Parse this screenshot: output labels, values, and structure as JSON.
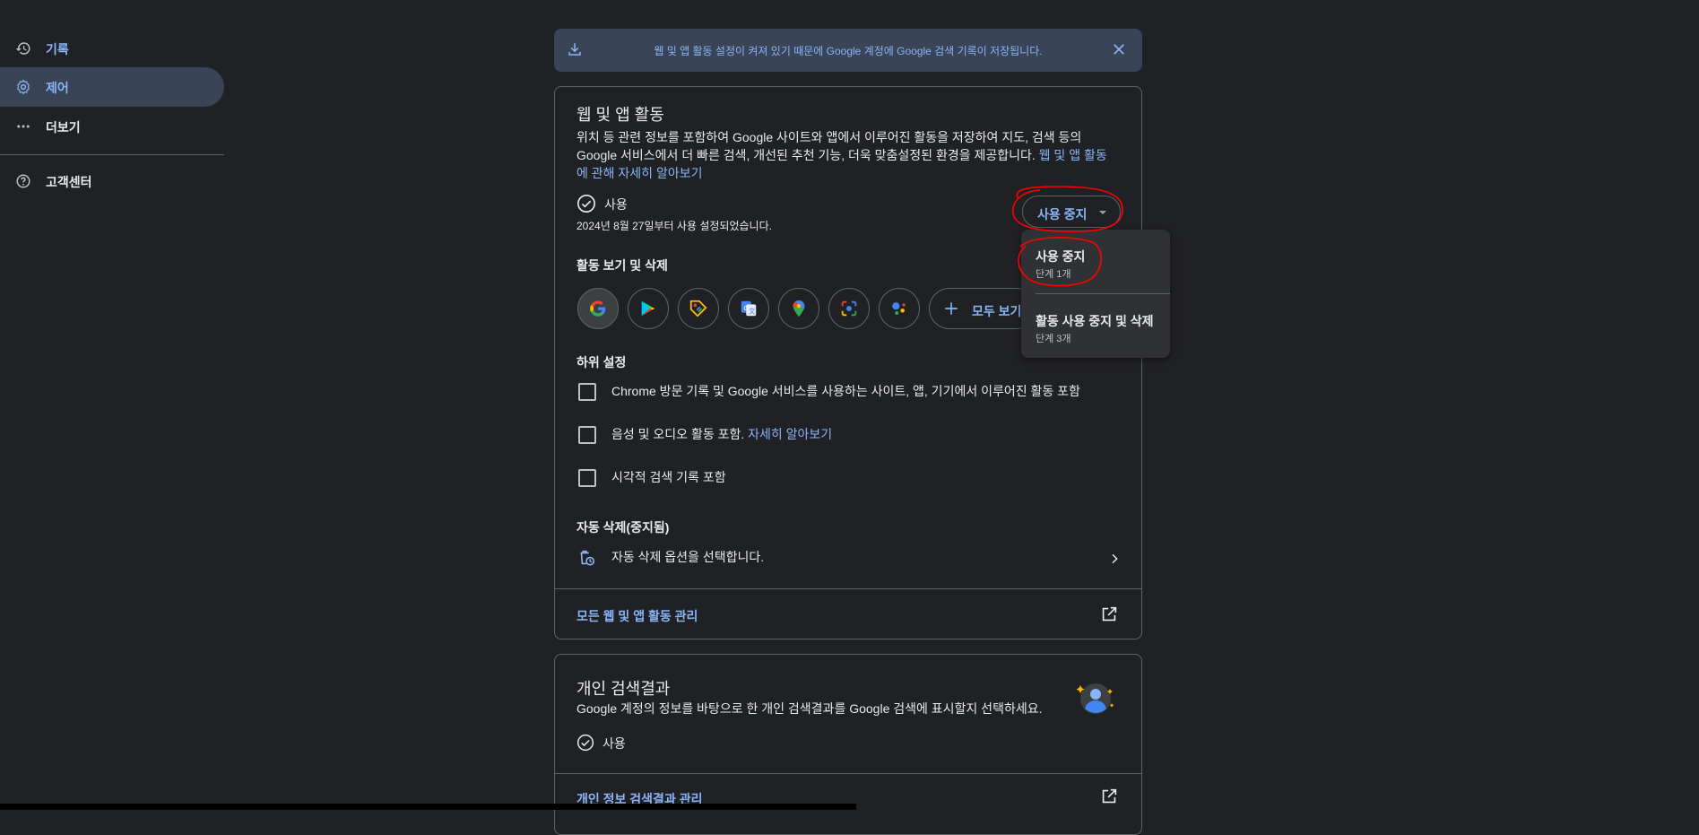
{
  "sidebar": {
    "items": [
      {
        "label": "기록",
        "icon": "history-icon"
      },
      {
        "label": "제어",
        "icon": "gear-icon"
      },
      {
        "label": "더보기",
        "icon": "more-horiz-icon"
      },
      {
        "label": "고객센터",
        "icon": "help-icon"
      }
    ]
  },
  "banner": {
    "text": "웹 및 앱 활동 설정이 켜져 있기 때문에 Google 계정에 Google 검색 기록이 저장됩니다."
  },
  "web_app_activity": {
    "title": "웹 및 앱 활동",
    "desc_line1": "위치 등 관련 정보를 포함하여 Google 사이트와 앱에서 이루어진 활동을 저장하여 지도, 검색 등의",
    "desc_line2": "Google 서비스에서 더 빠른 검색, 개선된 추천 기능, 더욱 맞춤설정된 환경을 제공합니다.",
    "learn_more_a": "웹 및 앱 활동",
    "learn_more_b": "에 관해 자세히 알아보기",
    "status": "사용",
    "status_since": "2024년 8월 27일부터 사용 설정되었습니다.",
    "pause_button": "사용 중지",
    "view_delete_title": "활동 보기 및 삭제",
    "app_icons": [
      "google-icon",
      "google-play-icon",
      "google-shopping-icon",
      "google-translate-icon",
      "google-maps-icon",
      "google-lens-icon",
      "google-assistant-icon"
    ],
    "view_all": "모두 보기",
    "sub_settings_title": "하위 설정",
    "sub_settings": [
      {
        "label": "Chrome 방문 기록 및 Google 서비스를 사용하는 사이트, 앱, 기기에서 이루어진 활동 포함",
        "checked": false
      },
      {
        "label": "음성 및 오디오 활동 포함.",
        "link": "자세히 알아보기",
        "checked": false
      },
      {
        "label": "시각적 검색 기록 포함",
        "checked": false
      }
    ],
    "auto_delete_title": "자동 삭제(중지됨)",
    "auto_delete_text": "자동 삭제 옵션을 선택합니다.",
    "manage_all": "모든 웹 및 앱 활동 관리"
  },
  "pause_menu": {
    "items": [
      {
        "title": "사용 중지",
        "sub": "단계 1개"
      },
      {
        "title": "활동 사용 중지 및 삭제",
        "sub": "단계 3개"
      }
    ]
  },
  "personal_results": {
    "title": "개인 검색결과",
    "desc": "Google 계정의 정보를 바탕으로 한 개인 검색결과를 Google 검색에 표시할지 선택하세요.",
    "status": "사용",
    "manage": "개인 정보 검색결과 관리"
  },
  "colors": {
    "background": "#202124",
    "accent": "#8ab4f8",
    "banner_bg": "#394457",
    "annotation": "#ff0000"
  }
}
